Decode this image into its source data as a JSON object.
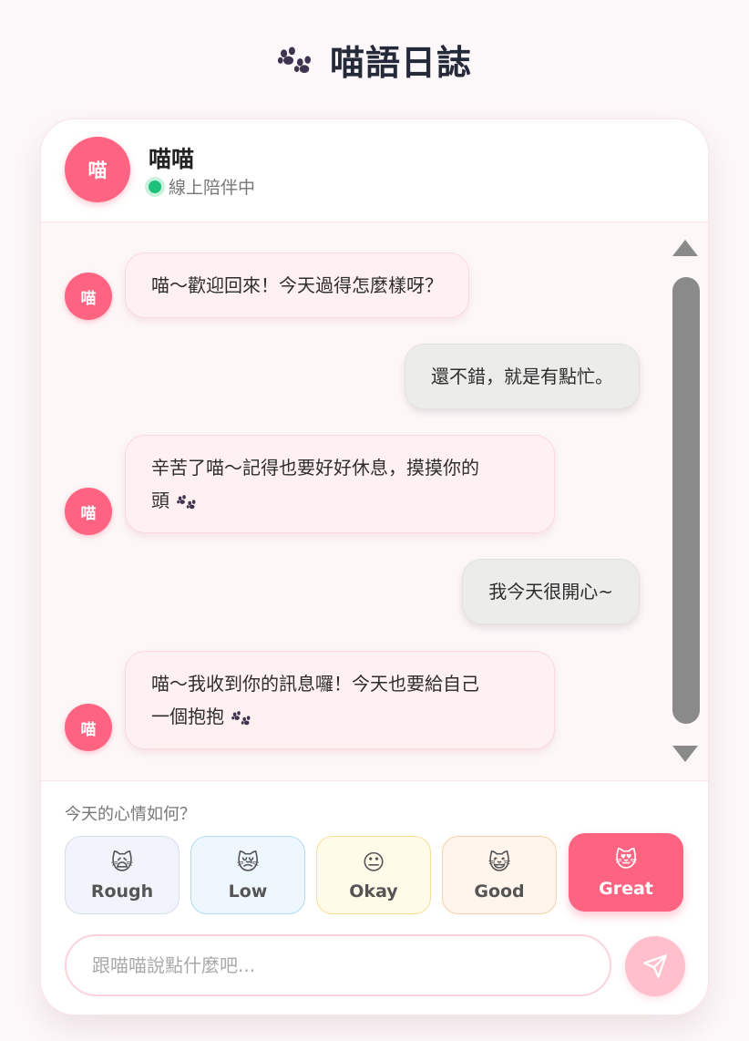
{
  "app": {
    "title": "喵語日誌"
  },
  "header": {
    "avatar": "喵",
    "name": "喵喵",
    "status": "線上陪伴中"
  },
  "messages": [
    {
      "from": "bot",
      "text": "喵～歡迎回來！今天過得怎麼樣呀？",
      "paw": false
    },
    {
      "from": "user",
      "text": "還不錯，就是有點忙。"
    },
    {
      "from": "bot",
      "line1": "辛苦了喵～記得也要好好休息，摸摸你的",
      "line2": "頭",
      "paw": true
    },
    {
      "from": "user",
      "text": "我今天很開心~"
    },
    {
      "from": "bot",
      "line1": "喵～我收到你的訊息囉！今天也要給自己",
      "line2": "一個抱抱",
      "paw": true
    }
  ],
  "bot_avatar": "喵",
  "mood": {
    "prompt": "今天的心情如何？",
    "options": [
      {
        "label": "Rough",
        "emoji": "🙀"
      },
      {
        "label": "Low",
        "emoji": "😿"
      },
      {
        "label": "Okay",
        "emoji": "😐"
      },
      {
        "label": "Good",
        "emoji": "😺"
      },
      {
        "label": "Great",
        "emoji": "😻"
      }
    ],
    "selected": "Great"
  },
  "composer": {
    "placeholder": "跟喵喵說點什麼吧...",
    "value": ""
  },
  "icons": {
    "title": "paw-icon",
    "send": "send-icon"
  },
  "colors": {
    "accent": "#fe6481",
    "online": "#1fc07a",
    "send_bg": "#ffbfcb"
  }
}
